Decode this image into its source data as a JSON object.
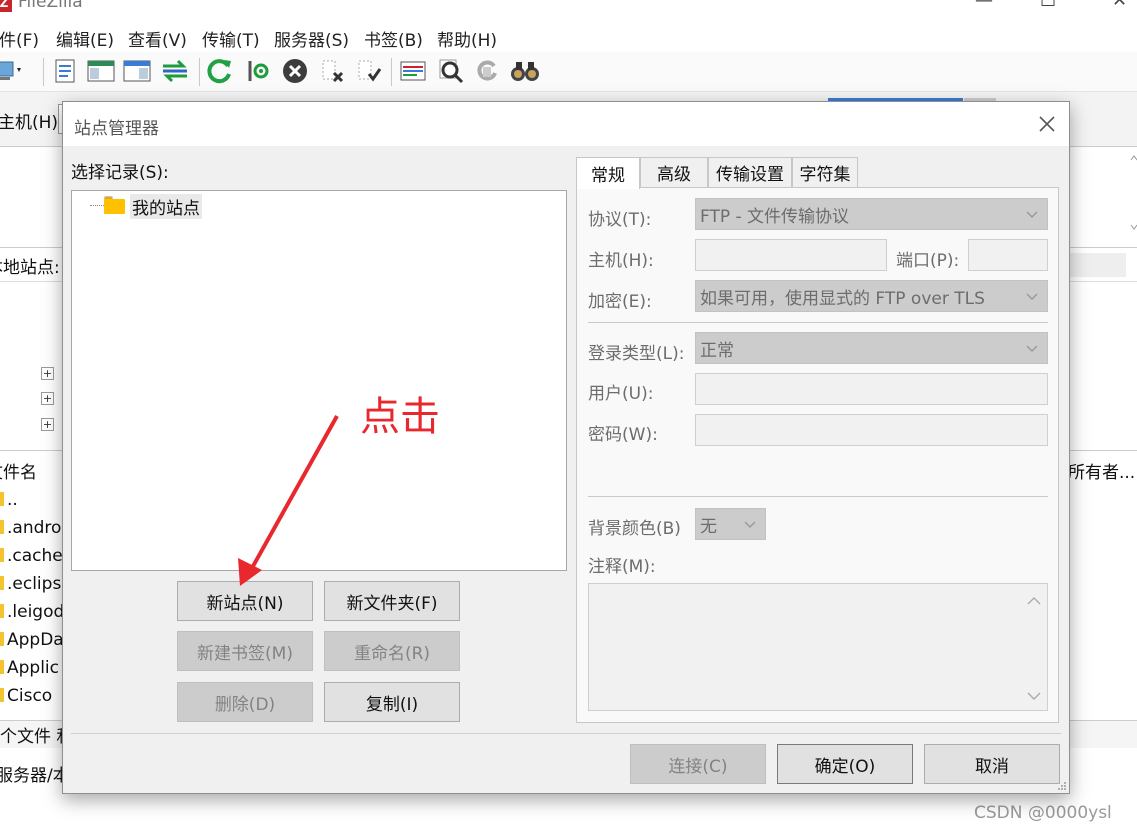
{
  "app": {
    "title": "FileZilla",
    "menu": [
      "文件(F)",
      "编辑(E)",
      "查看(V)",
      "传输(T)",
      "服务器(S)",
      "书签(B)",
      "帮助(H)"
    ]
  },
  "quickconnect": {
    "host_label": "主机(H):"
  },
  "local_site": {
    "label": "本地站点:"
  },
  "filelist": {
    "header": "文件名",
    "owner_header": "所有者...",
    "rows": [
      "..",
      ".andro",
      ".cache",
      ".eclips",
      ".leigod",
      "AppDa",
      "Applic",
      "Cisco"
    ]
  },
  "status": {
    "files_text": "个文件 和",
    "queue_text": "服务器/本"
  },
  "dialog": {
    "title": "站点管理器",
    "select_label": "选择记录(S):",
    "tree_root": "我的站点",
    "buttons": {
      "new_site": "新站点(N)",
      "new_folder": "新文件夹(F)",
      "new_bookmark": "新建书签(M)",
      "rename": "重命名(R)",
      "delete": "删除(D)",
      "copy": "复制(I)",
      "connect": "连接(C)",
      "ok": "确定(O)",
      "cancel": "取消"
    },
    "tabs": [
      "常规",
      "高级",
      "传输设置",
      "字符集"
    ],
    "form": {
      "protocol_label": "协议(T):",
      "protocol_value": "FTP - 文件传输协议",
      "host_label": "主机(H):",
      "port_label": "端口(P):",
      "encryption_label": "加密(E):",
      "encryption_value": "如果可用，使用显式的 FTP over TLS",
      "logon_type_label": "登录类型(L):",
      "logon_type_value": "正常",
      "user_label": "用户(U):",
      "password_label": "密码(W):",
      "bg_color_label": "背景颜色(B)",
      "bg_color_value": "无",
      "comments_label": "注释(M):"
    }
  },
  "annotation": {
    "text": "点击",
    "color": "#e8282c"
  },
  "watermark": "CSDN @0000ysl"
}
